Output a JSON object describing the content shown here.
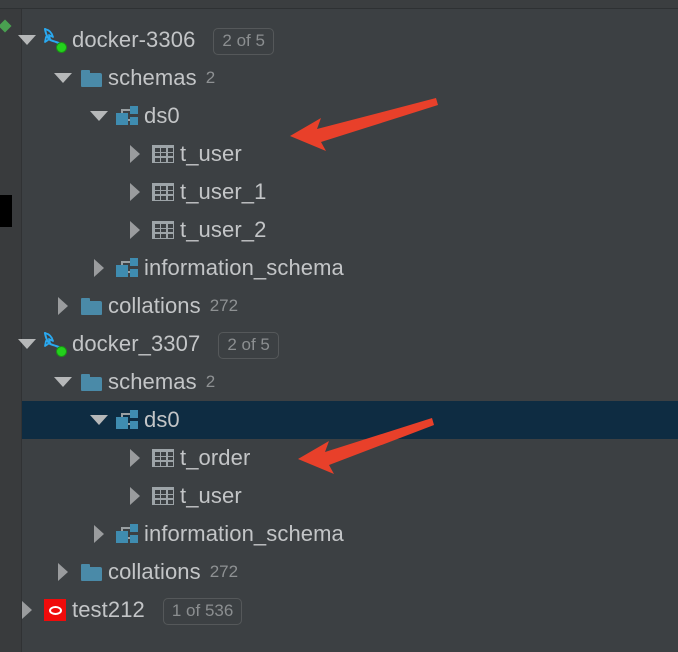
{
  "panel": {
    "name": "database-tree",
    "background_color": "#3c4043",
    "selection_color": "#0e2c42",
    "text_color": "#c3c5c7"
  },
  "gutter": {
    "green_marker": "changed-marker",
    "scroll_thumb": "scrollbar-thumb"
  },
  "annotations": {
    "color": "#e8402a",
    "arrows": [
      {
        "name": "arrow-pointing-t-user",
        "target": "t_user"
      },
      {
        "name": "arrow-pointing-t-order",
        "target": "t_order"
      }
    ]
  },
  "tree": {
    "rows": [
      {
        "id": "docker-3306",
        "label": "docker-3306",
        "icon": "mysql-dolphin-icon",
        "status": "connected",
        "twisty": "expanded",
        "badge": "2 of 5",
        "count": "",
        "depth": 0,
        "selected": false
      },
      {
        "id": "docker-3306-schemas",
        "label": "schemas",
        "icon": "folder-icon",
        "twisty": "expanded",
        "badge": "",
        "count": "2",
        "depth": 1,
        "selected": false
      },
      {
        "id": "docker-3306-ds0",
        "label": "ds0",
        "icon": "schema-icon",
        "twisty": "expanded",
        "badge": "",
        "count": "",
        "depth": 2,
        "selected": false
      },
      {
        "id": "docker-3306-ds0-t_user",
        "label": "t_user",
        "icon": "table-icon",
        "twisty": "collapsed",
        "badge": "",
        "count": "",
        "depth": 3,
        "selected": false
      },
      {
        "id": "docker-3306-ds0-t_user_1",
        "label": "t_user_1",
        "icon": "table-icon",
        "twisty": "collapsed",
        "badge": "",
        "count": "",
        "depth": 3,
        "selected": false
      },
      {
        "id": "docker-3306-ds0-t_user_2",
        "label": "t_user_2",
        "icon": "table-icon",
        "twisty": "collapsed",
        "badge": "",
        "count": "",
        "depth": 3,
        "selected": false
      },
      {
        "id": "docker-3306-information_schema",
        "label": "information_schema",
        "icon": "schema-icon",
        "twisty": "collapsed",
        "badge": "",
        "count": "",
        "depth": 2,
        "selected": false
      },
      {
        "id": "docker-3306-collations",
        "label": "collations",
        "icon": "folder-icon",
        "twisty": "collapsed",
        "badge": "",
        "count": "272",
        "depth": 1,
        "selected": false
      },
      {
        "id": "docker_3307",
        "label": "docker_3307",
        "icon": "mysql-dolphin-icon",
        "status": "connected",
        "twisty": "expanded",
        "badge": "2 of 5",
        "count": "",
        "depth": 0,
        "selected": false
      },
      {
        "id": "docker_3307-schemas",
        "label": "schemas",
        "icon": "folder-icon",
        "twisty": "expanded",
        "badge": "",
        "count": "2",
        "depth": 1,
        "selected": false
      },
      {
        "id": "docker_3307-ds0",
        "label": "ds0",
        "icon": "schema-icon",
        "twisty": "expanded",
        "badge": "",
        "count": "",
        "depth": 2,
        "selected": true
      },
      {
        "id": "docker_3307-ds0-t_order",
        "label": "t_order",
        "icon": "table-icon",
        "twisty": "collapsed",
        "badge": "",
        "count": "",
        "depth": 3,
        "selected": false
      },
      {
        "id": "docker_3307-ds0-t_user",
        "label": "t_user",
        "icon": "table-icon",
        "twisty": "collapsed",
        "badge": "",
        "count": "",
        "depth": 3,
        "selected": false
      },
      {
        "id": "docker_3307-information_schema",
        "label": "information_schema",
        "icon": "schema-icon",
        "twisty": "collapsed",
        "badge": "",
        "count": "",
        "depth": 2,
        "selected": false
      },
      {
        "id": "docker_3307-collations",
        "label": "collations",
        "icon": "folder-icon",
        "twisty": "collapsed",
        "badge": "",
        "count": "272",
        "depth": 1,
        "selected": false
      },
      {
        "id": "test212",
        "label": "test212",
        "icon": "oracle-icon",
        "twisty": "collapsed",
        "badge": "1 of 536",
        "count": "",
        "depth": 0,
        "selected": false
      }
    ]
  }
}
